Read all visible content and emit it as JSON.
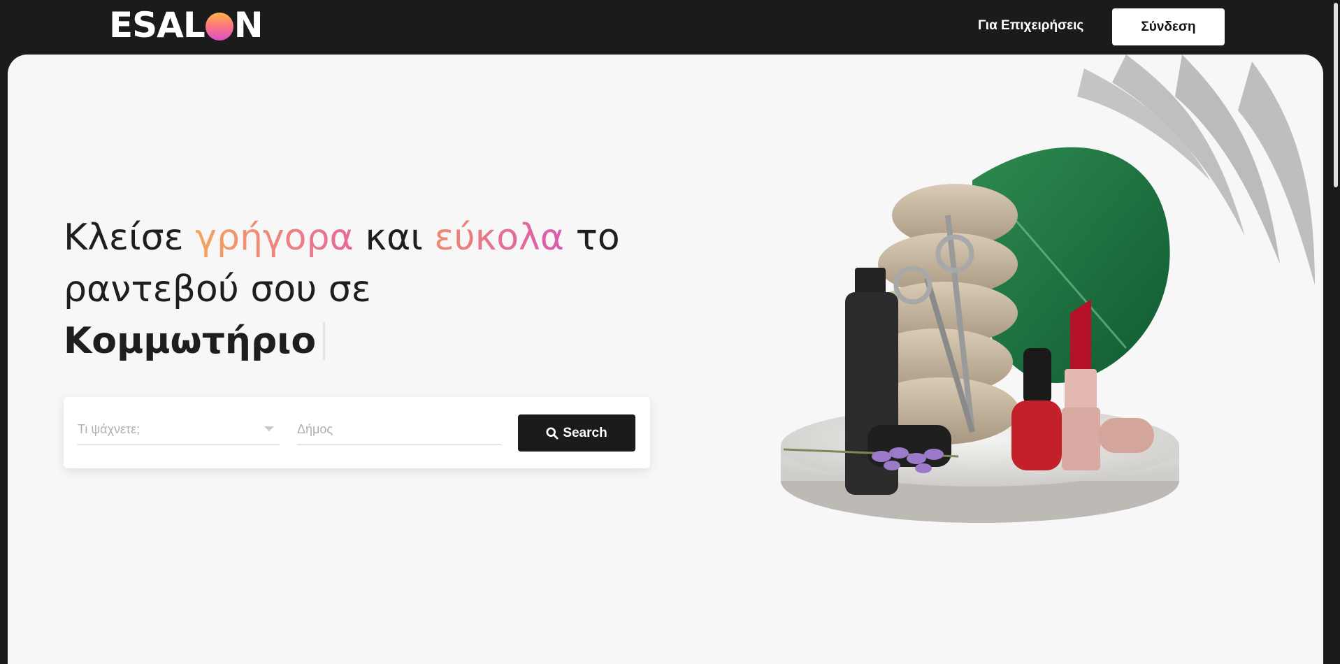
{
  "header": {
    "logo_text_left": "ESAL",
    "logo_text_right": "N",
    "business_link": "Για Επιχειρήσεις",
    "login_label": "Σύνδεση"
  },
  "hero": {
    "headline_part1": "Κλείσε ",
    "headline_highlight1": "γρήγορα",
    "headline_part2": " και ",
    "headline_highlight2": "εύκολα",
    "headline_part3": " το ραντεβού σου σε",
    "headline_category": "Κομμωτήριο"
  },
  "search": {
    "what_placeholder": "Τι ψάχνετε;",
    "where_placeholder": "Δήμος",
    "button_label": "Search"
  },
  "colors": {
    "dark": "#1b1b1b",
    "page_bg": "#f7f7f7",
    "accent_start": "#f4a55c",
    "accent_end": "#d95ab2"
  }
}
